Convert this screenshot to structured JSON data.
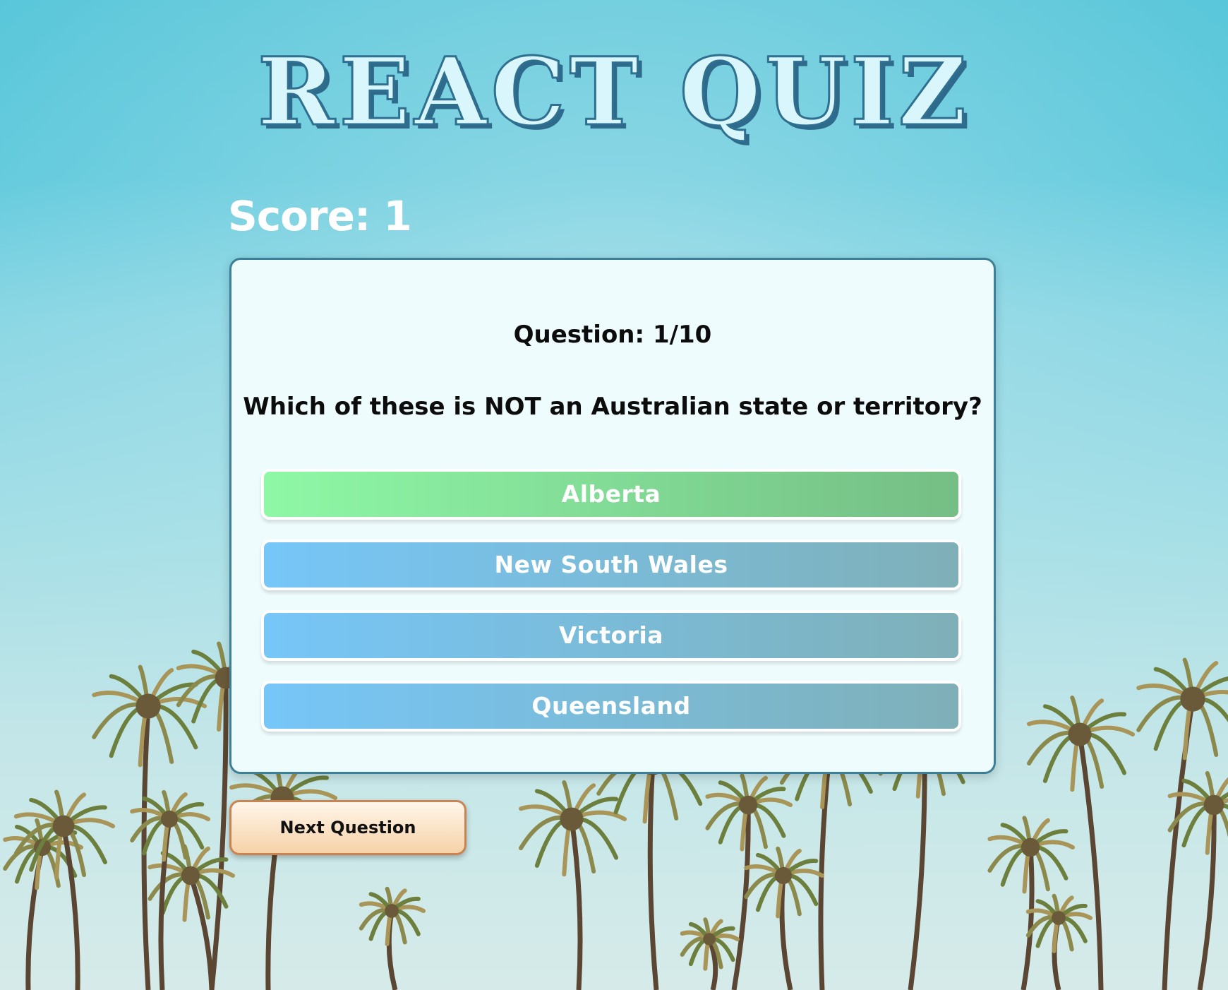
{
  "app": {
    "title": "REACT QUIZ"
  },
  "score": {
    "label": "Score: 1"
  },
  "quiz": {
    "question_number": "Question: 1/10",
    "question_text": "Which of these is NOT an Australian state or territory?",
    "answers": [
      {
        "label": "Alberta",
        "state": "correct"
      },
      {
        "label": "New South Wales",
        "state": "neutral"
      },
      {
        "label": "Victoria",
        "state": "neutral"
      },
      {
        "label": "Queensland",
        "state": "neutral"
      }
    ]
  },
  "controls": {
    "next_label": "Next Question"
  },
  "colors": {
    "sky_top": "#57c6d9",
    "card_bg": "#effcfd",
    "card_border": "#3d7e99",
    "correct_start": "#8ef8a6",
    "correct_end": "#75be85",
    "answer_start": "#76c6f8",
    "answer_end": "#7fb0b8",
    "next_border": "#c98451"
  },
  "background": {
    "scene": "palm-trees-under-blue-sky"
  }
}
